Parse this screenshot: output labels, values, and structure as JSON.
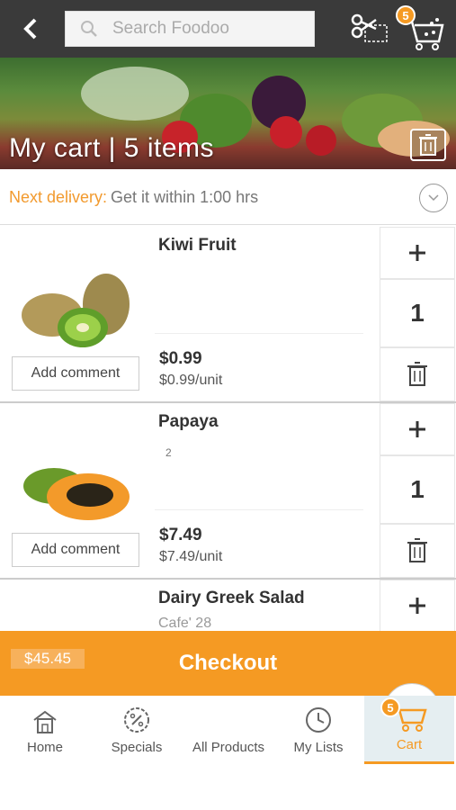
{
  "header": {
    "search_placeholder": "Search Foodoo",
    "cart_badge": "5"
  },
  "hero": {
    "title": "My cart | 5 items"
  },
  "delivery": {
    "label": "Next delivery:",
    "value": "Get it within 1:00 hrs"
  },
  "items": [
    {
      "name": "Kiwi Fruit",
      "note": "",
      "price": "$0.99",
      "unit_price": "$0.99/unit",
      "quantity": "1",
      "comment_label": "Add comment"
    },
    {
      "name": "Papaya",
      "note": "2",
      "price": "$7.49",
      "unit_price": "$7.49/unit",
      "quantity": "1",
      "comment_label": "Add comment"
    },
    {
      "name": "Dairy Greek Salad",
      "note": "Cafe' 28"
    }
  ],
  "checkout": {
    "total": "$45.45",
    "label": "Checkout"
  },
  "nav": {
    "tabs": [
      {
        "label": "Home",
        "icon": "home-icon"
      },
      {
        "label": "Specials",
        "icon": "percent-badge-icon"
      },
      {
        "label": "All Products",
        "icon": "list-icon"
      },
      {
        "label": "My Lists",
        "icon": "clock-list-icon"
      },
      {
        "label": "Cart",
        "icon": "cart-icon",
        "active": true
      }
    ],
    "cart_badge": "5"
  },
  "colors": {
    "accent": "#f59a23",
    "topbar": "#3a3a3a"
  }
}
